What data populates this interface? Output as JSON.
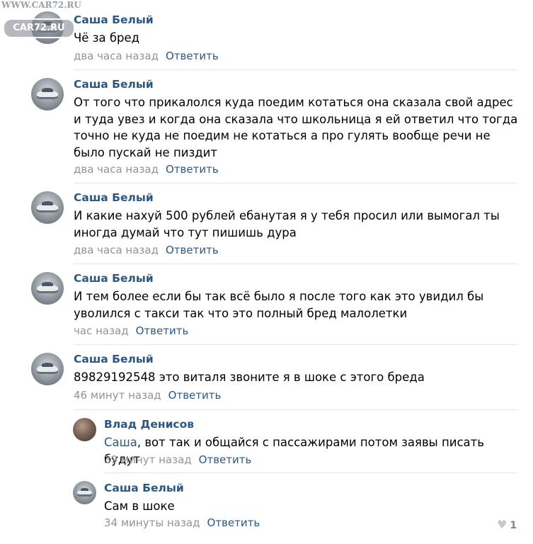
{
  "watermark": {
    "site": "WWW.CAR72.RU",
    "logo": "CAR72.RU"
  },
  "comments": [
    {
      "author": "Саша Белый",
      "text": "Чё за бред",
      "time": "два часа назад",
      "reply": "Ответить"
    },
    {
      "author": "Саша Белый",
      "text": "От того что прикалолся куда поедим котаться она сказала свой адрес и туда увез и когда она сказала что школьница я ей ответил что тогда точно не куда не поедим не котаться а про гулять вообще речи не было пускай не пиздит",
      "time": "два часа назад",
      "reply": "Ответить"
    },
    {
      "author": "Саша Белый",
      "text": "И какие нахуй 500 рублей ебанутая я у тебя просил или вымогал ты иногда думай что тут пишишь дура",
      "time": "два часа назад",
      "reply": "Ответить"
    },
    {
      "author": "Саша Белый",
      "text": "И тем более если бы так всё было я после того как это увидил бы уволился с такси так что это полный бред малолетки",
      "time": "час назад",
      "reply": "Ответить"
    },
    {
      "author": "Саша Белый",
      "text": "89829192548 это виталя звоните я в шоке с этого бреда",
      "time": "46 минут назад",
      "reply": "Ответить"
    }
  ],
  "replies": [
    {
      "author": "Влад Денисов",
      "mention": "Саша",
      "text": ", вот так и общайся с пассажирами потом заявы писать будут",
      "time": "39 минут назад",
      "reply": "Ответить"
    },
    {
      "author": "Саша Белый",
      "text": "Сам в шоке",
      "time": "34 минуты назад",
      "reply": "Ответить",
      "likes": "1"
    }
  ]
}
